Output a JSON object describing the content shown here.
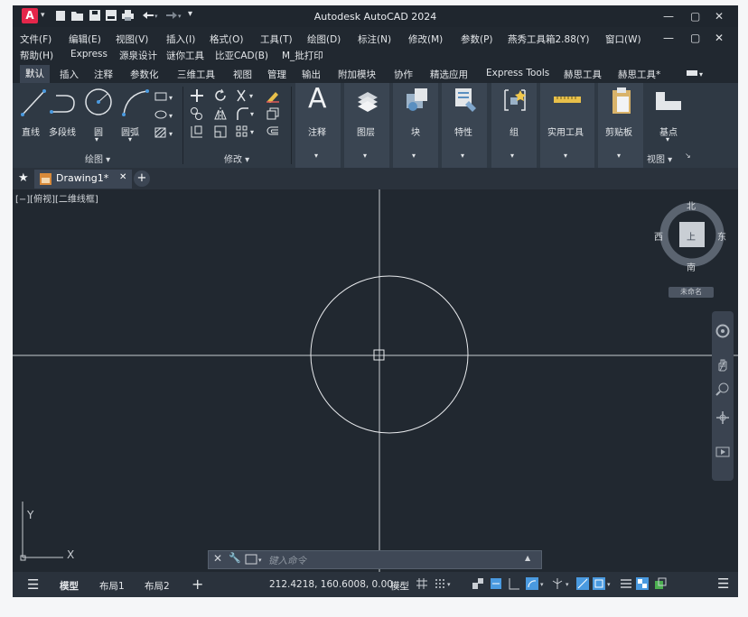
{
  "window": {
    "title": "Autodesk AutoCAD 2024",
    "logo_letter": "A",
    "controls": {
      "minimize": "—",
      "maximize": "▢",
      "close": "✕"
    },
    "mdi_controls": {
      "minimize": "—",
      "restore": "▢",
      "close": "✕"
    }
  },
  "quick_access": [
    "new-icon",
    "open-icon",
    "save-icon",
    "saveas-icon",
    "print-icon",
    "undo-icon",
    "redo-icon",
    "customize-icon"
  ],
  "menubar": {
    "row1": [
      "文件(F)",
      "编辑(E)",
      "视图(V)",
      "插入(I)",
      "格式(O)",
      "工具(T)",
      "绘图(D)",
      "标注(N)",
      "修改(M)",
      "参数(P)",
      "燕秀工具箱2.88(Y)",
      "窗口(W)"
    ],
    "row2": [
      "帮助(H)",
      "Express",
      "源泉设计",
      "谜你工具",
      "比亚CAD(B)",
      "M_批打印"
    ]
  },
  "ribbon_tabs": [
    "默认",
    "插入",
    "注释",
    "参数化",
    "三维工具",
    "视图",
    "管理",
    "输出",
    "附加模块",
    "协作",
    "精选应用",
    "Express Tools",
    "赫思工具",
    "赫思工具*"
  ],
  "ribbon": {
    "draw_tools": [
      "直线",
      "多段线",
      "圆",
      "圆弧"
    ],
    "draw_panel": "绘图 ▾",
    "modify_panel": "修改 ▾",
    "big_buttons": [
      "注释",
      "图层",
      "块",
      "特性",
      "组",
      "实用工具",
      "剪贴板",
      "基点"
    ],
    "view_panel": "视图 ▾",
    "dropdown_arrow": "▾"
  },
  "doc_tabs": {
    "active": "Drawing1*",
    "add": "+"
  },
  "canvas": {
    "view_label": "[−][俯视][二维线框]",
    "viewcube": {
      "north": "北",
      "south": "南",
      "east": "东",
      "west": "西",
      "top_face": "上",
      "wcs": "未命名"
    },
    "ucs": {
      "x": "X",
      "y": "Y"
    }
  },
  "command": {
    "placeholder": "键入命令"
  },
  "status": {
    "layout_tabs": [
      "模型",
      "布局1",
      "布局2"
    ],
    "add_layout": "+",
    "coords": "212.4218, 160.6008, 0.00...",
    "model_btn": "模型"
  }
}
